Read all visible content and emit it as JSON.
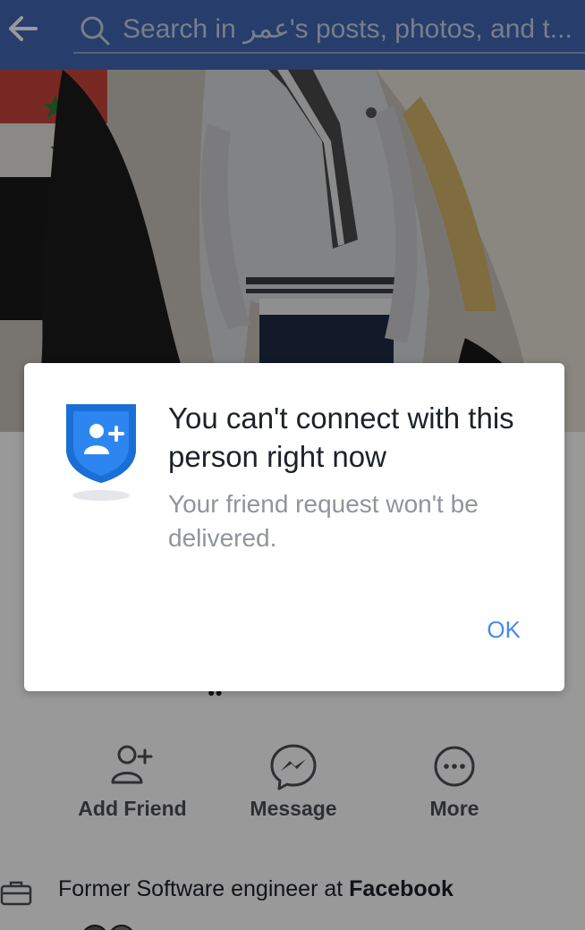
{
  "header": {
    "back_icon": "arrow-left-icon",
    "search_icon": "search-icon",
    "search_placeholder": "Search in عمر's posts, photos, and t..."
  },
  "profile": {
    "cover_photo": "cover-photo",
    "actions": [
      {
        "label": "Add Friend",
        "icon": "add-friend-icon"
      },
      {
        "label": "Message",
        "icon": "messenger-icon"
      },
      {
        "label": "More",
        "icon": "more-icon"
      }
    ],
    "work": {
      "icon": "briefcase-icon",
      "prefix": "Former Software engineer at ",
      "company": "Facebook"
    }
  },
  "dialog": {
    "icon": "shield-add-friend-icon",
    "title": "You can't connect with this person right now",
    "message": "Your friend request won't be delivered.",
    "ok_label": "OK"
  },
  "colors": {
    "header_bg": "#4267b2",
    "accent_blue": "#4a8ae8",
    "shield_blue": "#1a6fd6",
    "title_text": "#1d2129",
    "secondary_text": "#90949c"
  }
}
